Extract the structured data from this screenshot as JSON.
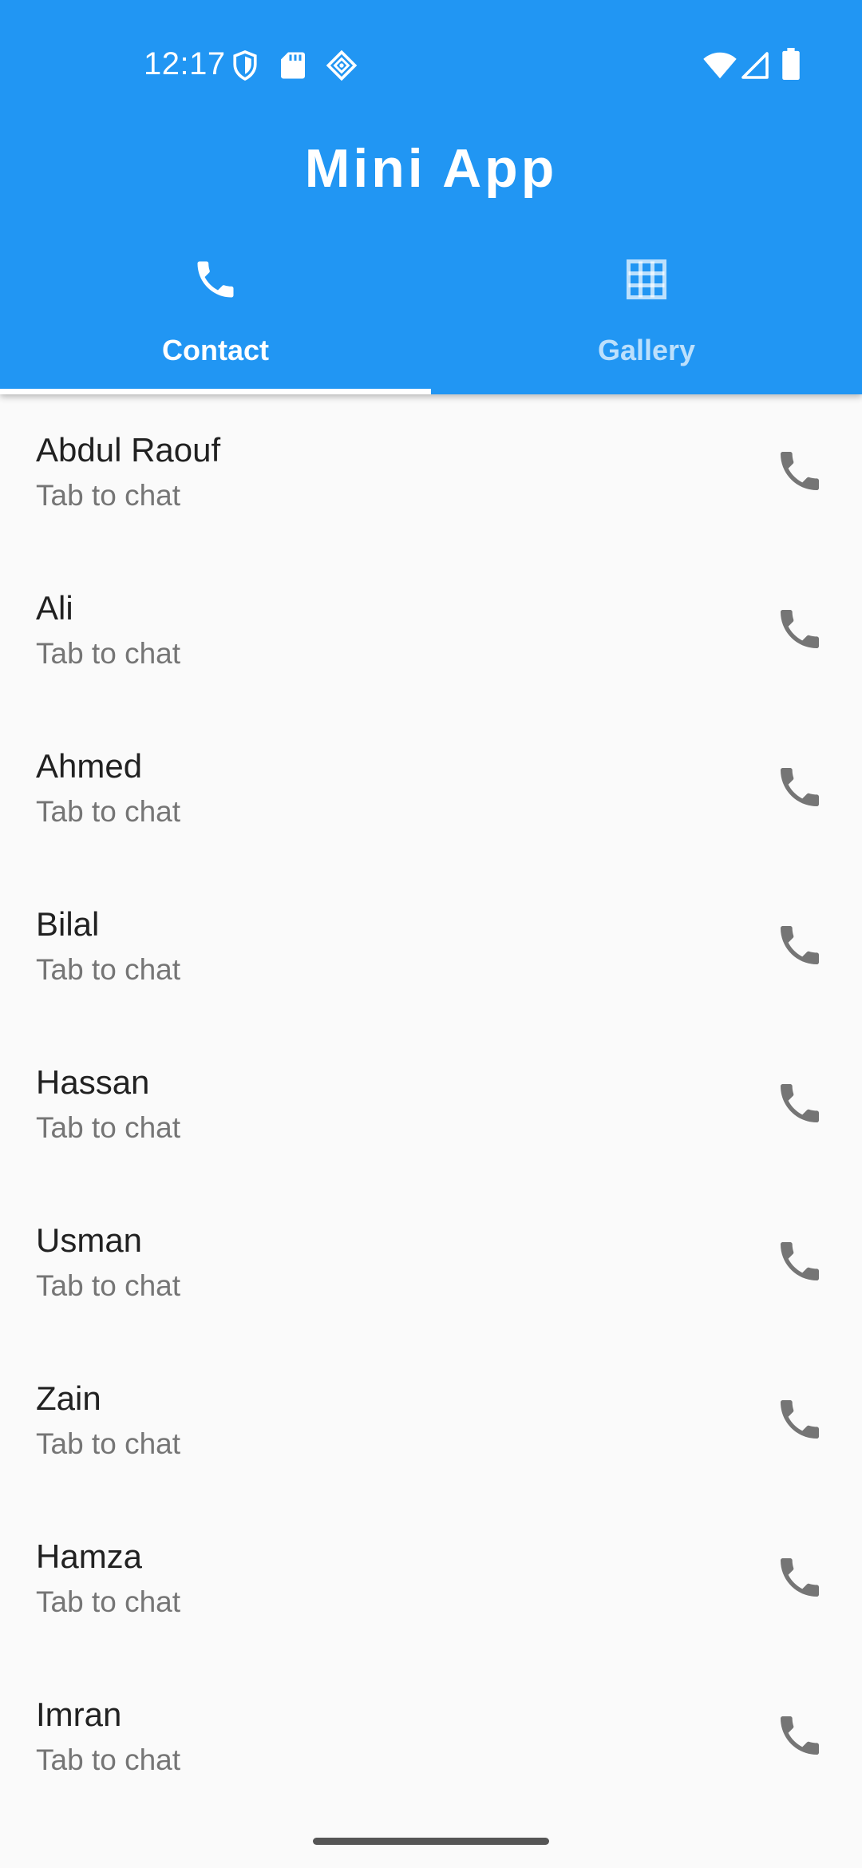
{
  "status_bar": {
    "time": "12:17",
    "left_icons": [
      "shield-icon",
      "sd-card-icon",
      "diamond-icon"
    ],
    "right_icons": [
      "wifi-icon",
      "signal-icon",
      "battery-icon"
    ]
  },
  "app_bar": {
    "title": "Mini App",
    "background_color": "#2196f3"
  },
  "tabs": [
    {
      "label": "Contact",
      "icon": "phone-icon",
      "selected": true
    },
    {
      "label": "Gallery",
      "icon": "grid-icon",
      "selected": false
    }
  ],
  "contacts": [
    {
      "name": "Abdul Raouf",
      "subtitle": "Tab to chat",
      "action_icon": "phone-icon"
    },
    {
      "name": "Ali",
      "subtitle": "Tab to chat",
      "action_icon": "phone-icon"
    },
    {
      "name": "Ahmed",
      "subtitle": "Tab to chat",
      "action_icon": "phone-icon"
    },
    {
      "name": "Bilal",
      "subtitle": "Tab to chat",
      "action_icon": "phone-icon"
    },
    {
      "name": "Hassan",
      "subtitle": "Tab to chat",
      "action_icon": "phone-icon"
    },
    {
      "name": "Usman",
      "subtitle": "Tab to chat",
      "action_icon": "phone-icon"
    },
    {
      "name": "Zain",
      "subtitle": "Tab to chat",
      "action_icon": "phone-icon"
    },
    {
      "name": "Hamza",
      "subtitle": "Tab to chat",
      "action_icon": "phone-icon"
    },
    {
      "name": "Imran",
      "subtitle": "Tab to chat",
      "action_icon": "phone-icon"
    }
  ]
}
